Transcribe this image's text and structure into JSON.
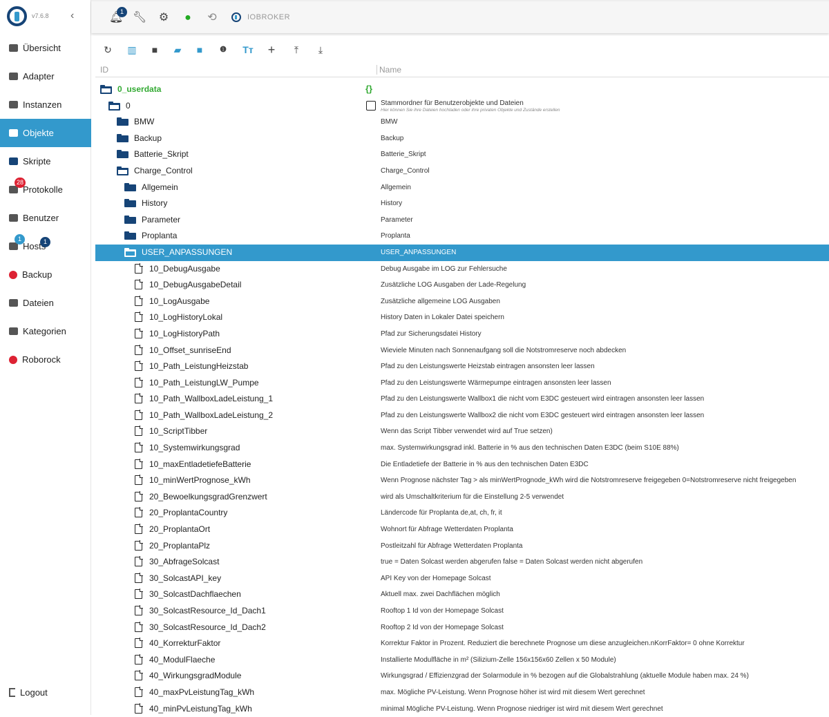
{
  "app": {
    "version": "v7.6.8",
    "brand": "IOBROKER"
  },
  "sidebar": {
    "items": [
      {
        "label": "Übersicht",
        "icon": "apps-icon"
      },
      {
        "label": "Adapter",
        "icon": "store-icon"
      },
      {
        "label": "Instanzen",
        "icon": "instances-icon"
      },
      {
        "label": "Objekte",
        "icon": "list-icon",
        "active": true
      },
      {
        "label": "Skripte",
        "icon": "js-icon"
      },
      {
        "label": "Protokolle",
        "icon": "log-icon",
        "badge": "28"
      },
      {
        "label": "Benutzer",
        "icon": "person-icon"
      },
      {
        "label": "Hosts",
        "icon": "hosts-icon",
        "badge": "1",
        "badge2": "1"
      },
      {
        "label": "Backup",
        "icon": "backup-icon"
      },
      {
        "label": "Dateien",
        "icon": "files-icon"
      },
      {
        "label": "Kategorien",
        "icon": "categories-icon"
      },
      {
        "label": "Roborock",
        "icon": "roborock-icon"
      }
    ],
    "logout": "Logout"
  },
  "topbar": {
    "notifications_badge": "1"
  },
  "table": {
    "col_id": "ID",
    "col_name": "Name"
  },
  "colors": {
    "accent": "#3399cc",
    "folder": "#164477",
    "green": "#33aa33"
  },
  "rows": [
    {
      "id": "0_userdata",
      "name": "",
      "type": "folder-open",
      "level": 0,
      "green": true,
      "nameIcon": "{}"
    },
    {
      "id": "0",
      "name": "Stammordner für Benutzerobjekte und Dateien",
      "sub": "Hier können Sie ihre Dateien hochladen oder ihre privaten Objekte und Zustände erstellen",
      "type": "folder-open",
      "level": 1
    },
    {
      "id": "BMW",
      "name": "BMW",
      "type": "folder",
      "level": 2
    },
    {
      "id": "Backup",
      "name": "Backup",
      "type": "folder",
      "level": 2
    },
    {
      "id": "Batterie_Skript",
      "name": "Batterie_Skript",
      "type": "folder",
      "level": 2
    },
    {
      "id": "Charge_Control",
      "name": "Charge_Control",
      "type": "folder-open",
      "level": 2
    },
    {
      "id": "Allgemein",
      "name": "Allgemein",
      "type": "folder",
      "level": 3
    },
    {
      "id": "History",
      "name": "History",
      "type": "folder",
      "level": 3
    },
    {
      "id": "Parameter",
      "name": "Parameter",
      "type": "folder",
      "level": 3
    },
    {
      "id": "Proplanta",
      "name": "Proplanta",
      "type": "folder",
      "level": 3
    },
    {
      "id": "USER_ANPASSUNGEN",
      "name": "USER_ANPASSUNGEN",
      "type": "folder-open",
      "level": 3,
      "selected": true
    },
    {
      "id": "10_DebugAusgabe",
      "name": "Debug Ausgabe im LOG zur Fehlersuche",
      "type": "file",
      "level": 4
    },
    {
      "id": "10_DebugAusgabeDetail",
      "name": "Zusätzliche LOG Ausgaben der Lade-Regelung",
      "type": "file",
      "level": 4
    },
    {
      "id": "10_LogAusgabe",
      "name": "Zusätzliche allgemeine LOG Ausgaben",
      "type": "file",
      "level": 4
    },
    {
      "id": "10_LogHistoryLokal",
      "name": "History Daten in Lokaler Datei speichern",
      "type": "file",
      "level": 4
    },
    {
      "id": "10_LogHistoryPath",
      "name": "Pfad zur Sicherungsdatei History",
      "type": "file",
      "level": 4
    },
    {
      "id": "10_Offset_sunriseEnd",
      "name": "Wieviele Minuten nach Sonnenaufgang soll die Notstromreserve noch abdecken",
      "type": "file",
      "level": 4
    },
    {
      "id": "10_Path_LeistungHeizstab",
      "name": "Pfad zu den Leistungswerte Heizstab eintragen ansonsten leer lassen",
      "type": "file",
      "level": 4
    },
    {
      "id": "10_Path_LeistungLW_Pumpe",
      "name": "Pfad zu den Leistungswerte Wärmepumpe eintragen ansonsten leer lassen",
      "type": "file",
      "level": 4
    },
    {
      "id": "10_Path_WallboxLadeLeistung_1",
      "name": "Pfad zu den Leistungswerte Wallbox1 die nicht vom E3DC gesteuert wird eintragen ansonsten leer lassen",
      "type": "file",
      "level": 4
    },
    {
      "id": "10_Path_WallboxLadeLeistung_2",
      "name": "Pfad zu den Leistungswerte Wallbox2 die nicht vom E3DC gesteuert wird eintragen ansonsten leer lassen",
      "type": "file",
      "level": 4
    },
    {
      "id": "10_ScriptTibber",
      "name": "Wenn das Script Tibber verwendet wird auf True setzen)",
      "type": "file",
      "level": 4
    },
    {
      "id": "10_Systemwirkungsgrad",
      "name": "max. Systemwirkungsgrad inkl. Batterie in % aus den technischen Daten E3DC (beim S10E 88%)",
      "type": "file",
      "level": 4
    },
    {
      "id": "10_maxEntladetiefeBatterie",
      "name": "Die Entladetiefe der Batterie in % aus den technischen Daten E3DC",
      "type": "file",
      "level": 4
    },
    {
      "id": "10_minWertPrognose_kWh",
      "name": "Wenn Prognose nächster Tag > als minWertPrognode_kWh wird die Notstromreserve freigegeben 0=Notstromreserve nicht freigegeben",
      "type": "file",
      "level": 4
    },
    {
      "id": "20_BewoelkungsgradGrenzwert",
      "name": "wird als Umschaltkriterium für die Einstellung 2-5 verwendet",
      "type": "file",
      "level": 4
    },
    {
      "id": "20_ProplantaCountry",
      "name": "Ländercode für Proplanta de,at, ch, fr, it",
      "type": "file",
      "level": 4
    },
    {
      "id": "20_ProplantaOrt",
      "name": "Wohnort für Abfrage Wetterdaten Proplanta",
      "type": "file",
      "level": 4
    },
    {
      "id": "20_ProplantaPlz",
      "name": "Postleitzahl für Abfrage Wetterdaten Proplanta",
      "type": "file",
      "level": 4
    },
    {
      "id": "30_AbfrageSolcast",
      "name": "true = Daten Solcast werden abgerufen false = Daten Solcast werden nicht abgerufen",
      "type": "file",
      "level": 4
    },
    {
      "id": "30_SolcastAPI_key",
      "name": "API Key von der Homepage Solcast",
      "type": "file",
      "level": 4
    },
    {
      "id": "30_SolcastDachflaechen",
      "name": "Aktuell max. zwei Dachflächen möglich",
      "type": "file",
      "level": 4
    },
    {
      "id": "30_SolcastResource_Id_Dach1",
      "name": "Rooftop 1 Id von der Homepage Solcast",
      "type": "file",
      "level": 4
    },
    {
      "id": "30_SolcastResource_Id_Dach2",
      "name": "Rooftop 2 Id von der Homepage Solcast",
      "type": "file",
      "level": 4
    },
    {
      "id": "40_KorrekturFaktor",
      "name": "Korrektur Faktor in Prozent. Reduziert die berechnete Prognose um diese anzugleichen.nKorrFaktor= 0 ohne Korrektur",
      "type": "file",
      "level": 4
    },
    {
      "id": "40_ModulFlaeche",
      "name": "Installierte Modulfläche in m² (Silizium-Zelle 156x156x60 Zellen x 50 Module)",
      "type": "file",
      "level": 4
    },
    {
      "id": "40_WirkungsgradModule",
      "name": "Wirkungsgrad / Effizienzgrad der Solarmodule in % bezogen auf die Globalstrahlung (aktuelle Module haben max. 24 %)",
      "type": "file",
      "level": 4
    },
    {
      "id": "40_maxPvLeistungTag_kWh",
      "name": "max. Mögliche PV-Leistung. Wenn Prognose höher ist wird mit diesem Wert gerechnet",
      "type": "file",
      "level": 4
    },
    {
      "id": "40_minPvLeistungTag_kWh",
      "name": "minimal Mögliche PV-Leistung. Wenn Prognose niedriger ist wird mit diesem Wert gerechnet",
      "type": "file",
      "level": 4
    }
  ]
}
